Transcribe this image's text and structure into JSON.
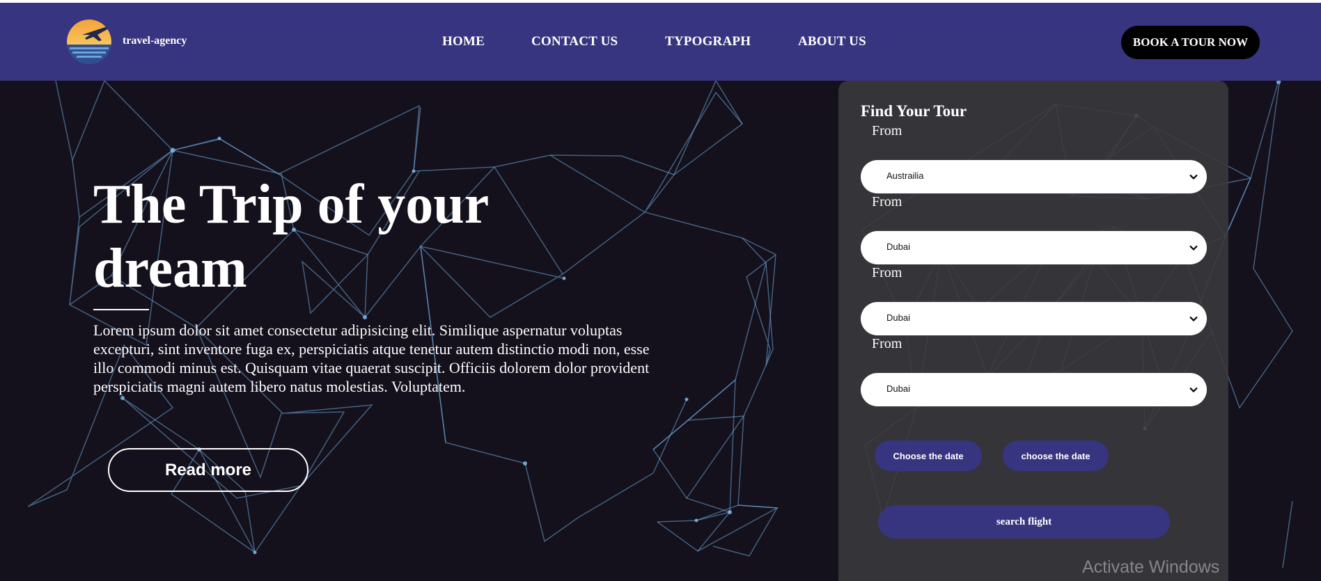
{
  "header": {
    "brand": "travel-agency",
    "nav": [
      "HOME",
      "CONTACT US",
      "TYPOGRAPH",
      "ABOUT US"
    ],
    "cta_label": "BOOK A TOUR NOW",
    "background_color": "#383580"
  },
  "hero": {
    "title": "The Trip of your dream",
    "description": "Lorem ipsum dolor sit amet consectetur adipisicing elit. Similique aspernatur voluptas excepturi, sint inventore fuga ex, perspiciatis atque tenetur autem distinctio modi non, esse illo commodi minus est. Quisquam vitae quaerat suscipit. Officiis dolorem dolor provident perspiciatis magni autem libero natus molestias. Voluptatem.",
    "read_more_label": "Read more",
    "background_color": "#14101c",
    "network_color": "#6aa6d6"
  },
  "search_panel": {
    "title": "Find Your Tour",
    "fields": [
      {
        "label": "From",
        "value": "Austrailia"
      },
      {
        "label": "From",
        "value": "Dubai"
      },
      {
        "label": "From",
        "value": "Dubai"
      },
      {
        "label": "From",
        "value": "Dubai"
      }
    ],
    "date_buttons": [
      "Choose the date",
      "choose the date"
    ],
    "search_label": "search flight",
    "accent_color": "#383580"
  },
  "watermark": "Activate Windows",
  "icons": {
    "logo": "sunset-airplane-logo",
    "select_arrow": "chevron-down-icon"
  }
}
